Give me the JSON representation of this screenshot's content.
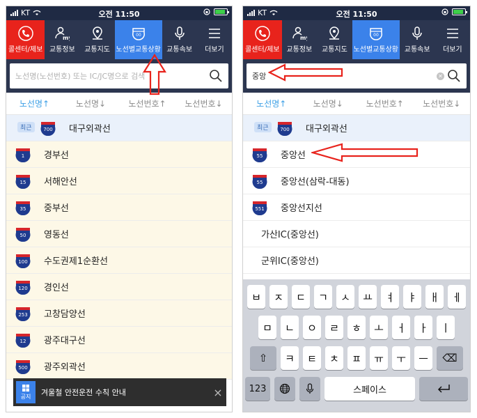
{
  "status": {
    "carrier": "KT",
    "time": "오전 11:50"
  },
  "nav": {
    "items": [
      {
        "label": "콜센터/제보",
        "icon": "phone-icon"
      },
      {
        "label": "교통정보",
        "icon": "my-icon"
      },
      {
        "label": "교통지도",
        "icon": "map-pin-icon"
      },
      {
        "label": "노선별교통상황",
        "icon": "highway-shield-icon"
      },
      {
        "label": "교통속보",
        "icon": "microphone-icon"
      },
      {
        "label": "더보기",
        "icon": "menu-icon"
      }
    ]
  },
  "left": {
    "search_placeholder": "노선명(노선번호) 또는 IC/JC명으로 검색",
    "sorts": [
      "노선명↑",
      "노선명↓",
      "노선번호↑",
      "노선번호↓"
    ],
    "recent_badge": "최근",
    "recent": {
      "num": "700",
      "name": "대구외곽선"
    },
    "routes": [
      {
        "num": "1",
        "name": "경부선"
      },
      {
        "num": "15",
        "name": "서해안선"
      },
      {
        "num": "35",
        "name": "중부선"
      },
      {
        "num": "50",
        "name": "영동선"
      },
      {
        "num": "100",
        "name": "수도권제1순환선"
      },
      {
        "num": "120",
        "name": "경인선"
      },
      {
        "num": "253",
        "name": "고창담양선"
      },
      {
        "num": "12",
        "name": "광주대구선"
      },
      {
        "num": "500",
        "name": "광주외곽선"
      }
    ],
    "notice": {
      "tag": "공지",
      "text": "겨울철 안전운전 수칙 안내",
      "close": "×"
    }
  },
  "right": {
    "search_value": "중앙",
    "sorts": [
      "노선명↑",
      "노선명↓",
      "노선번호↑",
      "노선번호↓"
    ],
    "recent_badge": "최근",
    "recent": {
      "num": "700",
      "name": "대구외곽선"
    },
    "results": [
      {
        "num": "55",
        "name": "중앙선"
      },
      {
        "num": "55",
        "name": "중앙선(삼락-대동)"
      },
      {
        "num": "551",
        "name": "중앙선지선"
      }
    ],
    "ic_results": [
      "가산IC(중앙선)",
      "군위IC(중앙선)",
      "군위IC(중앙선)"
    ]
  },
  "keyboard": {
    "row1": [
      "ㅂ",
      "ㅈ",
      "ㄷ",
      "ㄱ",
      "ㅅ",
      "ㅛ",
      "ㅕ",
      "ㅑ",
      "ㅐ",
      "ㅔ"
    ],
    "row2": [
      "ㅁ",
      "ㄴ",
      "ㅇ",
      "ㄹ",
      "ㅎ",
      "ㅗ",
      "ㅓ",
      "ㅏ",
      "ㅣ"
    ],
    "row3": [
      "ㅋ",
      "ㅌ",
      "ㅊ",
      "ㅍ",
      "ㅠ",
      "ㅜ",
      "ㅡ"
    ],
    "numbers": "123",
    "space": "스페이스"
  },
  "colors": {
    "accent": "#3b82ea",
    "callcenter": "#e8231c",
    "nav_bg": "#2c3650",
    "arrow": "#e8231c"
  }
}
